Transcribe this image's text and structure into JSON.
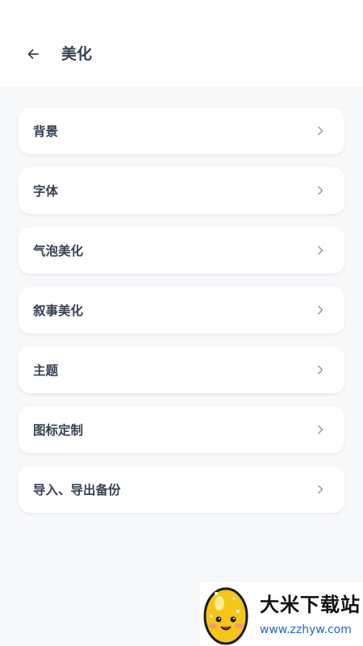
{
  "header": {
    "back_icon": "arrow-left-icon",
    "title": "美化"
  },
  "menu": {
    "items": [
      {
        "label": "背景",
        "icon": "chevron-right-icon"
      },
      {
        "label": "字体",
        "icon": "chevron-right-icon"
      },
      {
        "label": "气泡美化",
        "icon": "chevron-right-icon"
      },
      {
        "label": "叙事美化",
        "icon": "chevron-right-icon"
      },
      {
        "label": "主题",
        "icon": "chevron-right-icon"
      },
      {
        "label": "图标定制",
        "icon": "chevron-right-icon"
      },
      {
        "label": "导入、导出备份",
        "icon": "chevron-right-icon"
      }
    ]
  },
  "watermark": {
    "name": "大米下载站",
    "url": "www.zzhyw.com"
  },
  "colors": {
    "page_background": "#f6f8fa",
    "card_background": "#ffffff",
    "text_primary": "#374151",
    "chevron": "#9ca3af"
  }
}
